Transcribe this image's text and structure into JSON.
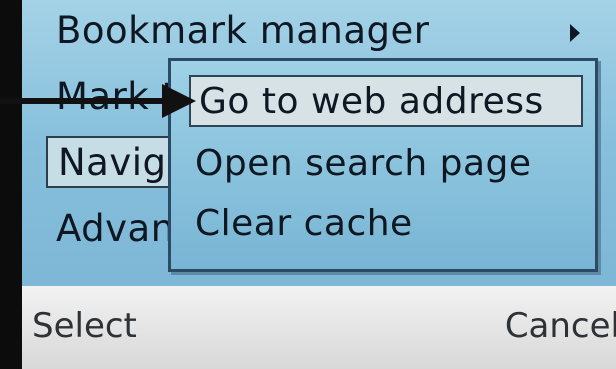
{
  "menu": {
    "items": [
      {
        "label": "Bookmark manager"
      },
      {
        "label": "Mark th"
      },
      {
        "label": "Naviga"
      },
      {
        "label": "Advanc"
      }
    ]
  },
  "popup": {
    "items": [
      {
        "label": "Go to web address"
      },
      {
        "label": "Open search page"
      },
      {
        "label": "Clear cache"
      }
    ]
  },
  "softkeys": {
    "left": "Select",
    "right": "Cancel"
  },
  "colors": {
    "screen_bg": "#86bfdc",
    "highlight": "#d6e2e6",
    "text": "#0e1722",
    "softkey_bar": "#e6e6e6"
  },
  "icons": {
    "submenu_indicator": "triangle-right-icon",
    "annotation_pointer": "arrow-right-icon"
  }
}
